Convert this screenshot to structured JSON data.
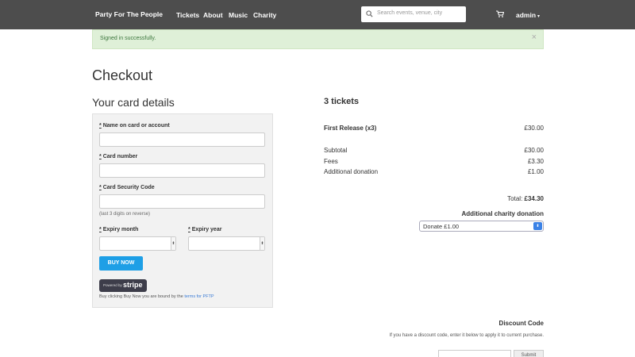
{
  "navbar": {
    "brand": "Party For The People",
    "links": [
      "Tickets",
      "About",
      "Music",
      "Charity"
    ],
    "search_placeholder": "Search events, venue, city",
    "user": "admin"
  },
  "alert": {
    "message": "Signed in successfully.",
    "close": "×"
  },
  "page_title": "Checkout",
  "card": {
    "title": "Your card details",
    "required_marker": "*",
    "name_label": "Name on card or account",
    "number_label": "Card number",
    "cvc_label": "Card Security Code",
    "cvc_help": "(last 3 digits on reverse)",
    "month_label": "Expiry month",
    "year_label": "Expiry year",
    "buy_label": "BUY NOW",
    "stripe_small": "Powered by",
    "stripe_logo": "stripe",
    "terms_prefix": "Buy clicking Buy Now you are bound by the",
    "terms_link": "terms for PFTP"
  },
  "summary": {
    "tickets_title": "3 tickets",
    "release_label": "First Release (x3)",
    "release_value": "£30.00",
    "subtotal_label": "Subtotal",
    "subtotal_value": "£30.00",
    "fees_label": "Fees",
    "fees_value": "£3.30",
    "donation_label": "Additional donation",
    "donation_value": "£1.00",
    "total_label": "Total:",
    "total_value": "£34.30",
    "charity_title": "Additional charity donation",
    "charity_selected": "Donate £1.00"
  },
  "discount": {
    "title": "Discount Code",
    "help": "If you have a discount code, enter it below to apply it to current purchase.",
    "submit": "Submit"
  }
}
